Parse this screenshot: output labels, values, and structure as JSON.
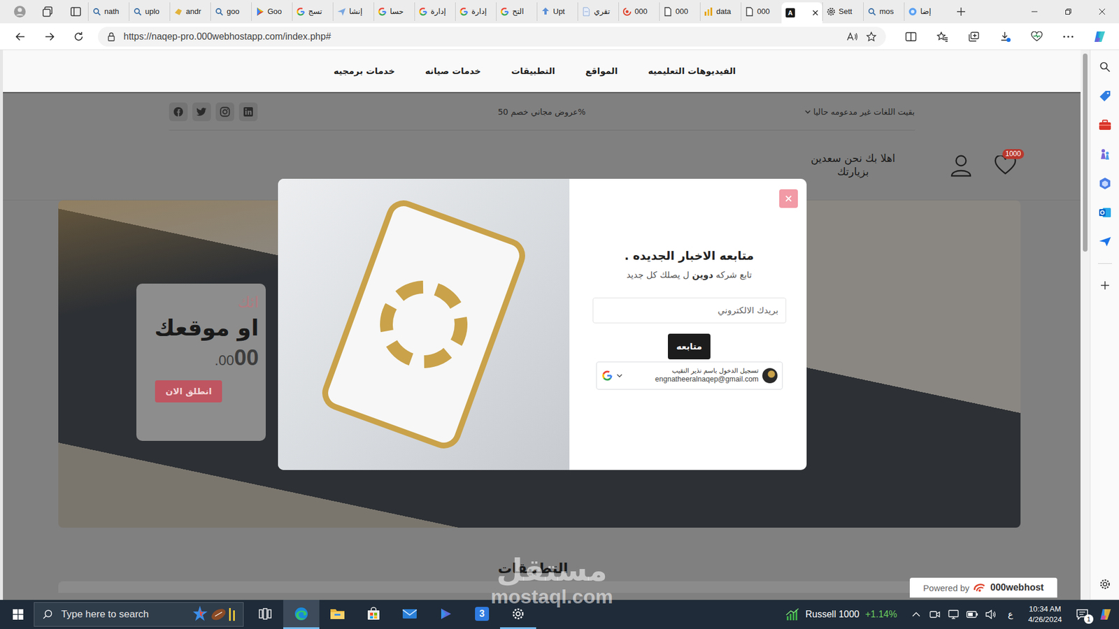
{
  "browser": {
    "tabs": [
      {
        "kind": "search",
        "label": "nath",
        "selected": false
      },
      {
        "kind": "search",
        "label": "uplo",
        "selected": false
      },
      {
        "kind": "hand",
        "label": "andr",
        "selected": false
      },
      {
        "kind": "search",
        "label": "goo",
        "selected": false
      },
      {
        "kind": "play",
        "label": "Goo",
        "selected": false
      },
      {
        "kind": "google",
        "label": "تسج",
        "selected": false
      },
      {
        "kind": "send",
        "label": "إنشا",
        "selected": false
      },
      {
        "kind": "google",
        "label": "حسا",
        "selected": false
      },
      {
        "kind": "google",
        "label": "إدارة",
        "selected": false
      },
      {
        "kind": "google",
        "label": "إدارة",
        "selected": false
      },
      {
        "kind": "google",
        "label": "التح",
        "selected": false
      },
      {
        "kind": "upload",
        "label": "Upt",
        "selected": false
      },
      {
        "kind": "docblue",
        "label": "تقري",
        "selected": false
      },
      {
        "kind": "webhost",
        "label": "000",
        "selected": false
      },
      {
        "kind": "doc",
        "label": "000",
        "selected": false
      },
      {
        "kind": "data",
        "label": "data",
        "selected": false
      },
      {
        "kind": "doc",
        "label": "000",
        "selected": false
      },
      {
        "kind": "letter",
        "favicon": "A",
        "selected": true
      },
      {
        "kind": "gear",
        "label": "Sett",
        "selected": false
      },
      {
        "kind": "search",
        "label": "mos",
        "selected": false
      },
      {
        "kind": "circle",
        "label": "إضا",
        "selected": false
      }
    ],
    "url": "https://naqep-pro.000webhostapp.com/index.php#"
  },
  "site": {
    "nav": [
      "الفيديوهات التعليميه",
      "المواقع",
      "التطبيقات",
      "خدمات صيانه",
      "خدمات برمجيه"
    ],
    "topbar": {
      "social": [
        "facebook",
        "twitter",
        "instagram",
        "linkedin"
      ],
      "offer": "%عروض مجاني خصم 50",
      "language": "بقيت اللغات غير مدعومه حاليا"
    },
    "header": {
      "greeting": [
        "اهلا بك نحن سعدين",
        "بزيارتك"
      ],
      "wishlist_count": "1000"
    },
    "hero": {
      "label": "ائك",
      "title": "او موقعك",
      "price": "00",
      "price_cents": ".00",
      "button": "انطلق الان"
    },
    "section_title": "التطبيقات",
    "powered_by": {
      "text": "Powered by",
      "brand": "000webhost"
    }
  },
  "modal": {
    "title": "متابعه الاخبار الجديده .",
    "subtitle": {
      "before": "تابع شركه",
      "brand": "دوين",
      "after": "ل يصلك كل جديد"
    },
    "email_placeholder": "بريدك الالكتروني",
    "submit": "متابعه",
    "google": {
      "name": "تسجيل الدخول باسم نذير النقيب",
      "email": "engnatheeralnaqep@gmail.com"
    }
  },
  "watermark": {
    "brand": "مستقل",
    "domain": "mostaql.com"
  },
  "edge_sidebar": [
    "search",
    "tag",
    "briefcase",
    "chess",
    "office",
    "outlook",
    "send"
  ],
  "taskbar": {
    "search_placeholder": "Type here to search",
    "apps": [
      {
        "kind": "taskview",
        "active": false,
        "running": false
      },
      {
        "kind": "edge",
        "active": true,
        "running": true
      },
      {
        "kind": "explorer",
        "active": false,
        "running": false
      },
      {
        "kind": "store",
        "active": false,
        "running": false
      },
      {
        "kind": "mail",
        "active": false,
        "running": false
      },
      {
        "kind": "media",
        "active": false,
        "running": false
      },
      {
        "kind": "app3",
        "label": "3",
        "active": false,
        "running": false
      },
      {
        "kind": "settings",
        "active": false,
        "running": true
      }
    ],
    "widget": {
      "name": "Russell 1000",
      "change": "+1.14%"
    },
    "ime": "ع",
    "time": "10:34 AM",
    "date": "4/26/2024",
    "notifications": "1"
  }
}
